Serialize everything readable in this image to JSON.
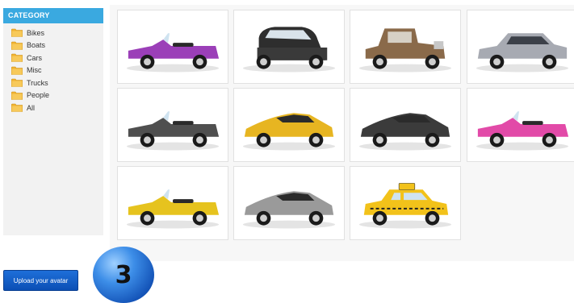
{
  "category": {
    "title": "CATEGORY",
    "items": [
      {
        "label": "Bikes",
        "icon": "folder-icon"
      },
      {
        "label": "Boats",
        "icon": "folder-icon"
      },
      {
        "label": "Cars",
        "icon": "folder-icon"
      },
      {
        "label": "Misc",
        "icon": "folder-icon"
      },
      {
        "label": "Trucks",
        "icon": "folder-icon"
      },
      {
        "label": "People",
        "icon": "folder-icon"
      },
      {
        "label": "All",
        "icon": "folder-icon"
      }
    ]
  },
  "avatars": [
    {
      "kind": "classic-convertible",
      "color": "#9b3fb8"
    },
    {
      "kind": "mini",
      "color": "#2e2e2e"
    },
    {
      "kind": "vintage",
      "color": "#8a6a4a"
    },
    {
      "kind": "luxury-sedan",
      "color": "#a7aab2"
    },
    {
      "kind": "sports-convertible",
      "color": "#4f4f4f"
    },
    {
      "kind": "supercar",
      "color": "#e7b521"
    },
    {
      "kind": "coupe",
      "color": "#3b3b3b"
    },
    {
      "kind": "roadster",
      "color": "#e24aa8"
    },
    {
      "kind": "roadster",
      "color": "#e6c31e"
    },
    {
      "kind": "supercar",
      "color": "#9a9a9a"
    },
    {
      "kind": "taxi",
      "color": "#f2c21a"
    }
  ],
  "upload_button": {
    "label": "Upload your avatar"
  },
  "step_badge": {
    "number": "3"
  },
  "colors": {
    "header": "#3aa9e0",
    "folder": "#f2b431",
    "button": "#1560c8"
  }
}
